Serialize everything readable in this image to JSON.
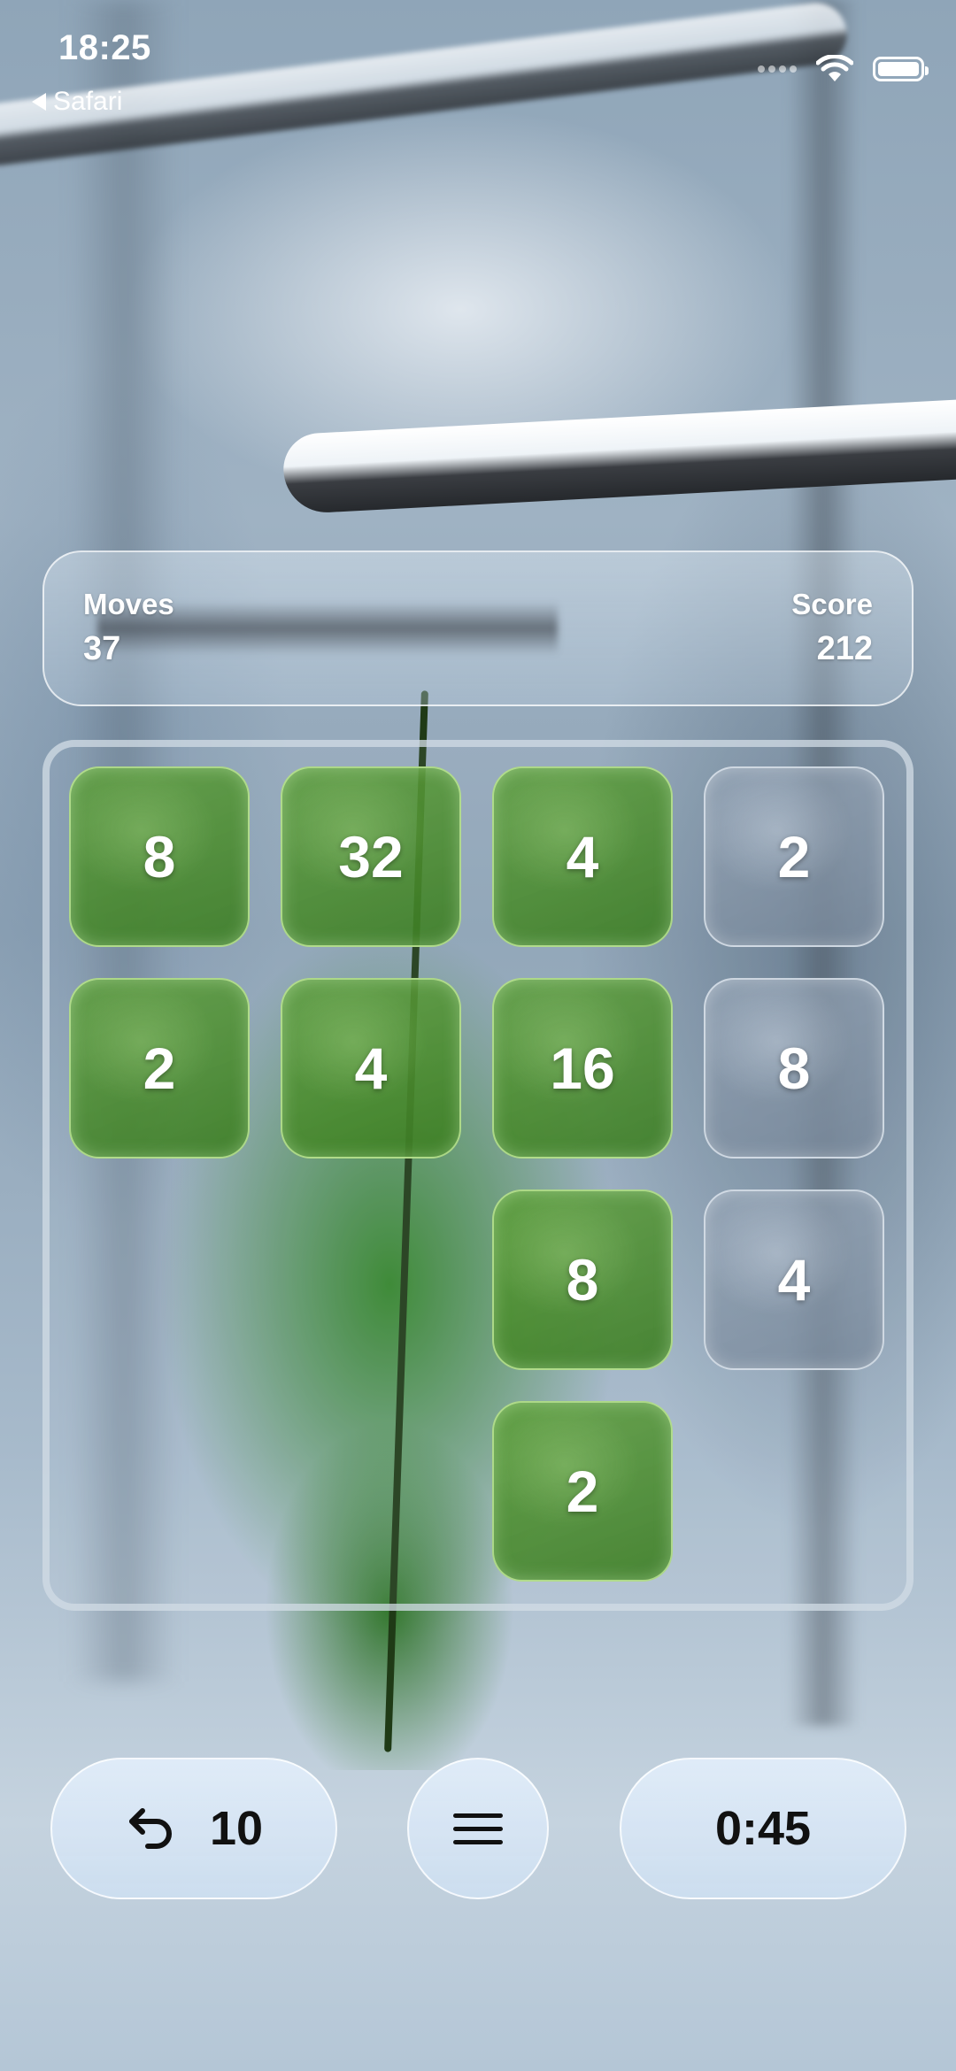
{
  "status_bar": {
    "time": "18:25",
    "back_label": "Safari"
  },
  "stats": {
    "moves_label": "Moves",
    "moves_value": "37",
    "score_label": "Score",
    "score_value": "212"
  },
  "board": {
    "grid_size": 4,
    "tiles": [
      {
        "row": 0,
        "col": 0,
        "value": "8",
        "style": "green"
      },
      {
        "row": 0,
        "col": 1,
        "value": "32",
        "style": "green"
      },
      {
        "row": 0,
        "col": 2,
        "value": "4",
        "style": "green"
      },
      {
        "row": 0,
        "col": 3,
        "value": "2",
        "style": "grey"
      },
      {
        "row": 1,
        "col": 0,
        "value": "2",
        "style": "green"
      },
      {
        "row": 1,
        "col": 1,
        "value": "4",
        "style": "green"
      },
      {
        "row": 1,
        "col": 2,
        "value": "16",
        "style": "green"
      },
      {
        "row": 1,
        "col": 3,
        "value": "8",
        "style": "grey"
      },
      {
        "row": 2,
        "col": 2,
        "value": "8",
        "style": "green"
      },
      {
        "row": 2,
        "col": 3,
        "value": "4",
        "style": "grey"
      },
      {
        "row": 3,
        "col": 2,
        "value": "2",
        "style": "green"
      }
    ]
  },
  "controls": {
    "undo_icon": "undo-arrow-icon",
    "undo_count": "10",
    "menu_icon": "hamburger-menu-icon",
    "timer": "0:45"
  },
  "icons": {
    "wifi": "wifi-icon",
    "battery": "battery-icon",
    "back": "back-arrow-icon"
  }
}
